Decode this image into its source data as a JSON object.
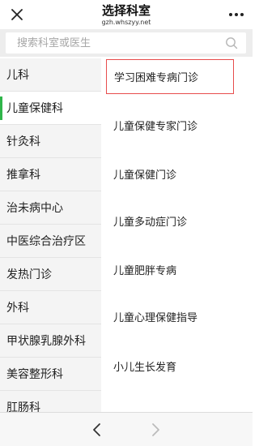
{
  "header": {
    "title": "选择科室",
    "subtitle": "gzh.whszyy.net",
    "close_icon": "close-icon",
    "more_icon": "more-horizontal-icon"
  },
  "search": {
    "placeholder": "搜索科室或医生",
    "icon": "search-icon"
  },
  "sidebar": {
    "accent_color": "#2fb54a",
    "active_index": 1,
    "items": [
      {
        "label": "儿科"
      },
      {
        "label": "儿童保健科"
      },
      {
        "label": "针灸科"
      },
      {
        "label": "推拿科"
      },
      {
        "label": "治未病中心"
      },
      {
        "label": "中医综合治疗区"
      },
      {
        "label": "发热门诊"
      },
      {
        "label": "外科"
      },
      {
        "label": "甲状腺乳腺外科"
      },
      {
        "label": "美容整形科"
      },
      {
        "label": "肛肠科"
      }
    ]
  },
  "clinics": {
    "highlight_color": "#e74c4c",
    "items": [
      {
        "label": "学习困难专病门诊"
      },
      {
        "label": "儿童保健专家门诊"
      },
      {
        "label": "儿童保健门诊"
      },
      {
        "label": "儿童多动症门诊"
      },
      {
        "label": "儿童肥胖专病"
      },
      {
        "label": "儿童心理保健指导"
      },
      {
        "label": "小儿生长发育"
      }
    ]
  },
  "bottom_nav": {
    "back_icon": "chevron-left-icon",
    "forward_icon": "chevron-right-icon"
  }
}
